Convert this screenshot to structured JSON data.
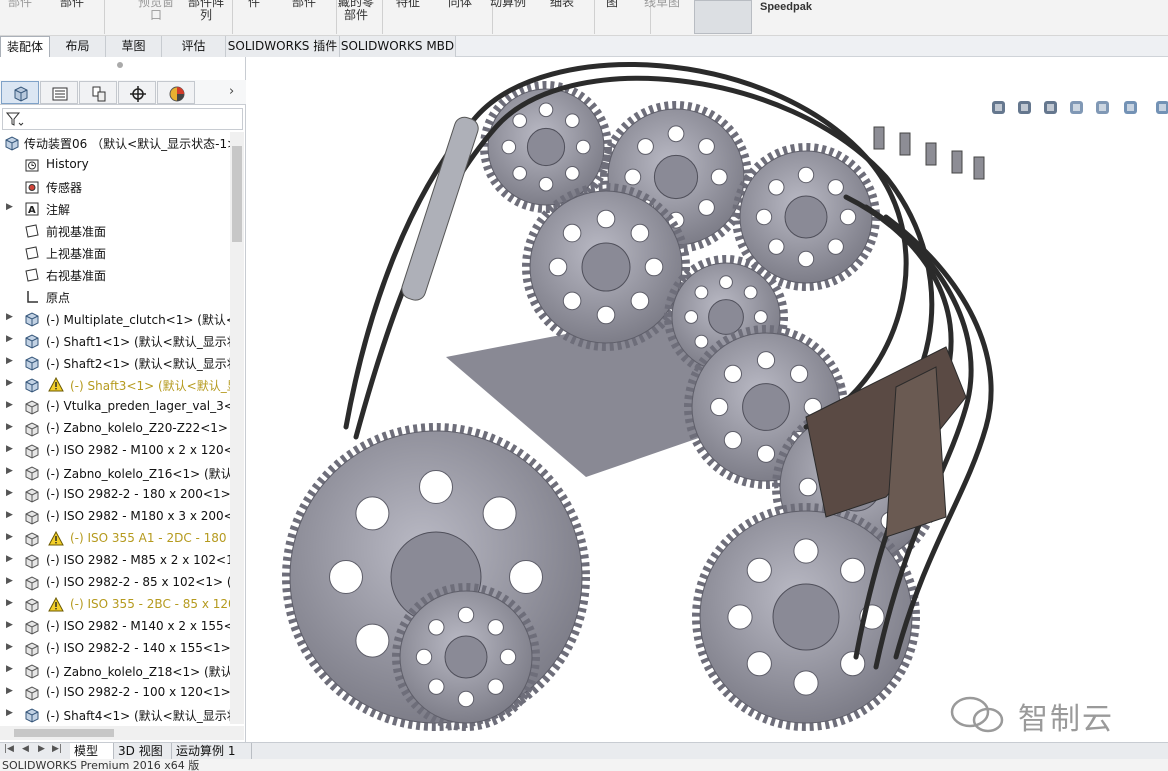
{
  "ribbon": {
    "items": [
      {
        "label": "部件",
        "grey": true
      },
      {
        "label": "部件",
        "grey": false
      },
      {
        "label": "预览窗\n口",
        "grey": true
      },
      {
        "label": "部件阵\n列",
        "grey": false
      },
      {
        "label": "件",
        "grey": false
      },
      {
        "label": "部件",
        "grey": false
      },
      {
        "label": "藏的零\n部件",
        "grey": false
      },
      {
        "label": "特征",
        "grey": false
      },
      {
        "label": "同体",
        "grey": false
      },
      {
        "label": "动算例",
        "grey": false
      },
      {
        "label": "细表",
        "grey": false
      },
      {
        "label": "图",
        "grey": false
      },
      {
        "label": "线草图",
        "grey": true
      }
    ],
    "speedpak": "Speedpak"
  },
  "command_tabs": [
    {
      "label": "装配体",
      "active": true
    },
    {
      "label": "布局",
      "active": false
    },
    {
      "label": "草图",
      "active": false
    },
    {
      "label": "评估",
      "active": false
    },
    {
      "label": "SOLIDWORKS 插件",
      "active": false
    },
    {
      "label": "SOLIDWORKS MBD",
      "active": false
    }
  ],
  "panel_tabs": [
    "featuremanager-icon",
    "propertymanager-icon",
    "configurationmanager-icon",
    "dimxpert-icon",
    "display-manager-icon"
  ],
  "tree": {
    "root": "传动装置06 （默认<默认_显示状态-1>",
    "items": [
      {
        "label": "History",
        "icon": "history-icon",
        "expand": false,
        "warn": false
      },
      {
        "label": "传感器",
        "icon": "sensor-icon",
        "expand": false,
        "warn": false
      },
      {
        "label": "注解",
        "icon": "annotation-icon",
        "expand": true,
        "warn": false
      },
      {
        "label": "前视基准面",
        "icon": "plane-icon",
        "expand": false,
        "warn": false
      },
      {
        "label": "上视基准面",
        "icon": "plane-icon",
        "expand": false,
        "warn": false
      },
      {
        "label": "右视基准面",
        "icon": "plane-icon",
        "expand": false,
        "warn": false
      },
      {
        "label": "原点",
        "icon": "origin-icon",
        "expand": false,
        "warn": false
      },
      {
        "label": "(-) Multiplate_clutch<1> (默认<默",
        "icon": "assembly-icon",
        "expand": true,
        "warn": false
      },
      {
        "label": "(-) Shaft1<1> (默认<默认_显示状",
        "icon": "assembly-icon",
        "expand": true,
        "warn": false
      },
      {
        "label": "(-) Shaft2<1> (默认<默认_显示状",
        "icon": "assembly-icon",
        "expand": true,
        "warn": false
      },
      {
        "label": "(-) Shaft3<1> (默认<默认_显",
        "icon": "assembly-icon",
        "expand": true,
        "warn": true
      },
      {
        "label": "(-) Vtulka_preden_lager_val_3<1",
        "icon": "part-icon",
        "expand": true,
        "warn": false
      },
      {
        "label": "(-) Zabno_kolelo_Z20-Z22<1> (",
        "icon": "part-icon",
        "expand": true,
        "warn": false
      },
      {
        "label": "(-) ISO 2982 - M100 x 2 x 120<",
        "icon": "part-icon",
        "expand": true,
        "warn": false
      },
      {
        "label": "(-) Zabno_kolelo_Z16<1> (默认<",
        "icon": "part-icon",
        "expand": true,
        "warn": false
      },
      {
        "label": "(-) ISO 2982-2 - 180 x 200<1> (",
        "icon": "part-icon",
        "expand": true,
        "warn": false
      },
      {
        "label": "(-) ISO 2982 - M180 x 3 x 200<",
        "icon": "part-icon",
        "expand": true,
        "warn": false
      },
      {
        "label": "(-) ISO 355 A1 - 2DC - 180 :",
        "icon": "part-icon",
        "expand": true,
        "warn": true
      },
      {
        "label": "(-) ISO 2982 - M85 x 2 x 102<1",
        "icon": "part-icon",
        "expand": true,
        "warn": false
      },
      {
        "label": "(-) ISO 2982-2 - 85 x 102<1> (",
        "icon": "part-icon",
        "expand": true,
        "warn": false
      },
      {
        "label": "(-) ISO 355 - 2BC - 85 x 120",
        "icon": "part-icon",
        "expand": true,
        "warn": true
      },
      {
        "label": "(-) ISO 2982 - M140 x 2 x 155<",
        "icon": "part-icon",
        "expand": true,
        "warn": false
      },
      {
        "label": "(-) ISO 2982-2 - 140 x 155<1> (",
        "icon": "part-icon",
        "expand": true,
        "warn": false
      },
      {
        "label": "(-) Zabno_kolelo_Z18<1> (默认<",
        "icon": "part-icon",
        "expand": true,
        "warn": false
      },
      {
        "label": "(-) ISO 2982-2 - 100 x 120<1> (",
        "icon": "part-icon",
        "expand": true,
        "warn": false
      },
      {
        "label": "(-) Shaft4<1> (默认<默认_显示状",
        "icon": "assembly-icon",
        "expand": true,
        "warn": false
      }
    ]
  },
  "bottom_tabs": [
    {
      "label": "模型",
      "active": true
    },
    {
      "label": "3D 视图",
      "active": false
    },
    {
      "label": "运动算例 1",
      "active": false
    }
  ],
  "status_text": "SOLIDWORKS Premium 2016 x64 版",
  "watermark": "智制云",
  "colors": {
    "accent": "#7fa2c8",
    "gear": "#8a8a96",
    "warn": "#b59a1e"
  }
}
